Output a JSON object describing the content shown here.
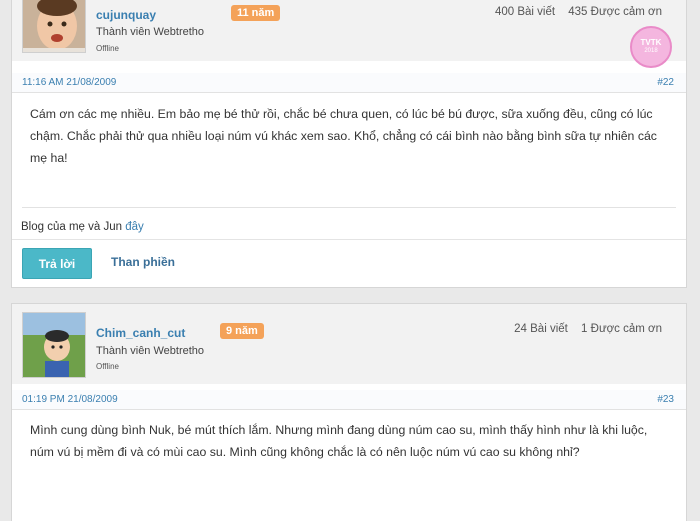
{
  "posts": [
    {
      "username": "cujunquay",
      "years_badge": "11 năm",
      "rank": "Thành viên Webtretho",
      "status": "Offline",
      "posts_count": "400 Bài viết",
      "thanks_count": "435 Được cảm ơn",
      "award_badge": {
        "line1": "TVTK",
        "line2": "2018",
        "color": "#f4b6df"
      },
      "timestamp": "11:16 AM 21/08/2009",
      "post_number": "#22",
      "content": "Cám ơn các mẹ nhiều. Em bảo mẹ bé thử rồi, chắc bé chưa quen, có lúc bé bú được, sữa xuống đều, cũng có lúc chậm. Chắc phải thử qua nhiều loại núm vú khác xem sao. Khổ, chẳng có cái bình nào bằng bình sữa tự nhiên các mẹ ha!",
      "signature_text": "Blog của mẹ và Jun",
      "signature_link": "đây",
      "reply_label": "Trả lời",
      "report_label": "Than phiền"
    },
    {
      "username": "Chim_canh_cut",
      "years_badge": "9 năm",
      "rank": "Thành viên Webtretho",
      "status": "Offline",
      "posts_count": "24 Bài viết",
      "thanks_count": "1 Được cảm ơn",
      "timestamp": "01:19 PM 21/08/2009",
      "post_number": "#23",
      "content": "Mình cung dùng bình Nuk, bé mút thích lắm. Nhưng mình đang dùng núm cao su, mình thấy hình như là khi luộc, núm vú bị mềm đi và có mùi cao su. Mình cũng không chắc là có nên luộc núm vú cao su không nhỉ?"
    }
  ],
  "colors": {
    "accent_blue": "#3a7fb0",
    "reply_button": "#4bb8c8",
    "years_badge": "#f4a259"
  }
}
